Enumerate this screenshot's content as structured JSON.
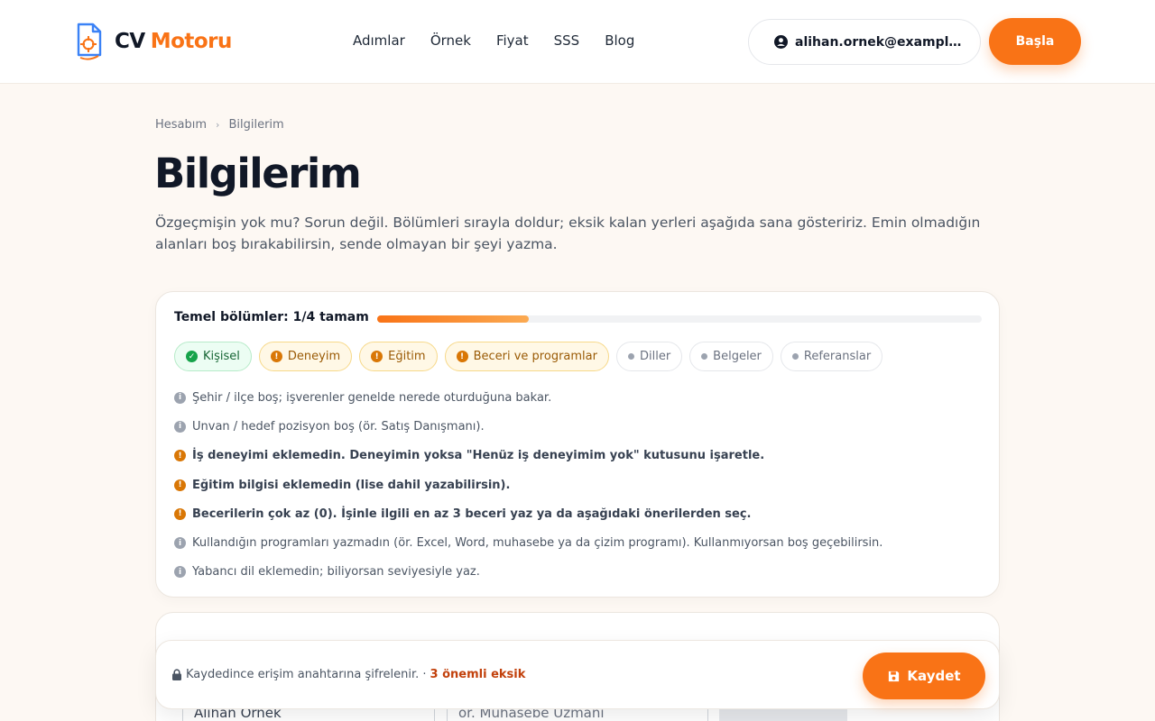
{
  "brand": {
    "cv": "CV",
    "motor": "Motoru"
  },
  "nav": {
    "items": [
      "Adımlar",
      "Örnek",
      "Fiyat",
      "SSS",
      "Blog"
    ]
  },
  "account": {
    "email": "alihan.ornek@example.com"
  },
  "header": {
    "start_label": "Başla"
  },
  "breadcrumb": {
    "items": [
      "Hesabım",
      "Bilgilerim"
    ]
  },
  "page": {
    "title": "Bilgilerim",
    "intro": "Özgeçmişin yok mu? Sorun değil. Bölümleri sırayla doldur; eksik kalan yerleri aşağıda sana gösteririz. Emin olmadığın alanları boş bırakabilirsin, sende olmayan bir şeyi yazma."
  },
  "progress": {
    "label": "Temel bölümler: 1/4 tamam",
    "fraction": 0.25
  },
  "sections": [
    {
      "label": "Kişisel",
      "status": "ok"
    },
    {
      "label": "Deneyim",
      "status": "warn"
    },
    {
      "label": "Eğitim",
      "status": "warn"
    },
    {
      "label": "Beceri ve programlar",
      "status": "warn"
    },
    {
      "label": "Diller",
      "status": "idle"
    },
    {
      "label": "Belgeler",
      "status": "idle"
    },
    {
      "label": "Referanslar",
      "status": "idle"
    }
  ],
  "issues": [
    {
      "type": "info",
      "text": "Şehir / ilçe boş; işverenler genelde nerede oturduğuna bakar."
    },
    {
      "type": "info",
      "text": "Unvan / hedef pozisyon boş (ör. Satış Danışmanı)."
    },
    {
      "type": "warn",
      "text": "İş deneyimi eklemedin. Deneyimin yoksa \"Henüz iş deneyimim yok\" kutusunu işaretle."
    },
    {
      "type": "warn",
      "text": "Eğitim bilgisi eklemedin (lise dahil yazabilirsin)."
    },
    {
      "type": "warn",
      "text": "Becerilerin çok az (0). İşinle ilgili en az 3 beceri yaz ya da aşağıdaki önerilerden seç."
    },
    {
      "type": "info",
      "text": "Kullandığın programları yazmadın (ör. Excel, Word, muhasebe ya da çizim programı). Kullanmıyorsan boş geçebilirsin."
    },
    {
      "type": "info",
      "text": "Yabancı dil eklemedin; biliyorsan seviyesiyle yaz."
    }
  ],
  "form": {
    "name_value": "Alihan Örnek",
    "title_placeholder": "ör. Muhasebe Uzmanı"
  },
  "savebar": {
    "note": "Kaydedince erişim anahtarına şifrelenir. ·",
    "missing": "3 önemli eksik",
    "save_label": "Kaydet"
  },
  "colors": {
    "accent": "#f97316",
    "ok": "#16a34a",
    "warn": "#d97706",
    "info": "#9ca3af"
  }
}
